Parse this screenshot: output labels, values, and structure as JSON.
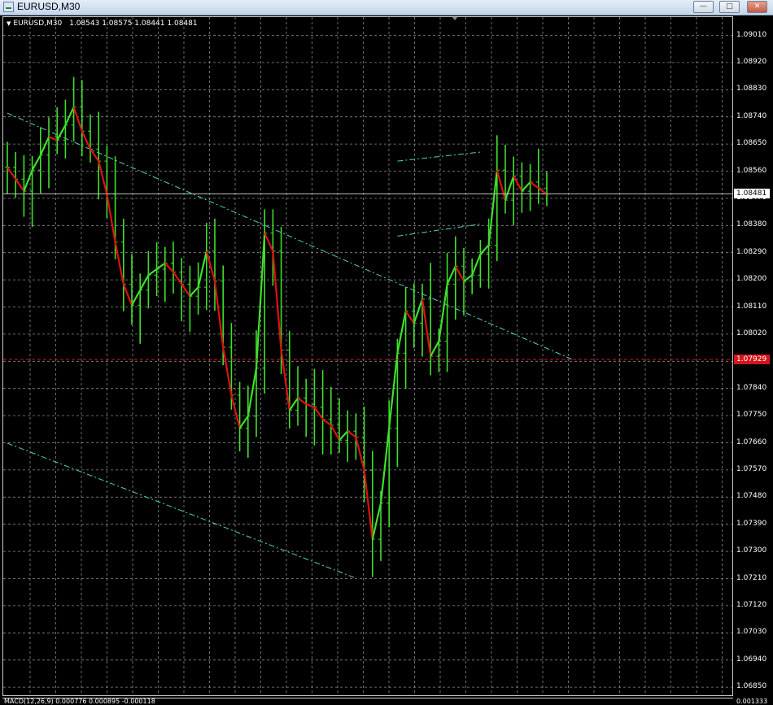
{
  "window": {
    "title": "EURUSD,M30",
    "buttons": {
      "minimize": "—",
      "maximize": "□",
      "close": "✕"
    }
  },
  "chart": {
    "info": {
      "symbol": "EURUSD,M30",
      "open": "1.08543",
      "high": "1.08575",
      "low": "1.08441",
      "close": "1.08481"
    },
    "price_ticks": [
      "1.09010",
      "1.08920",
      "1.08830",
      "1.08740",
      "1.08650",
      "1.08560",
      "1.08470",
      "1.08380",
      "1.08290",
      "1.08200",
      "1.08110",
      "1.08020",
      "1.07930",
      "1.07840",
      "1.07750",
      "1.07660",
      "1.07570",
      "1.07480",
      "1.07390",
      "1.07300",
      "1.07210",
      "1.07120",
      "1.07030",
      "1.06940",
      "1.06850"
    ],
    "bid_tag": "1.08481",
    "ref_tag": "1.07929",
    "colors": {
      "background": "#000000",
      "grid": "#8a8a8a",
      "bull": "#3fe02a",
      "bear": "#e01010",
      "trendline": "#4fd2c8",
      "ref_line": "#d4151b",
      "bid_line": "#c0c0c0"
    }
  },
  "chart_data": {
    "type": "line",
    "title": "EURUSD,M30",
    "xlabel": "",
    "ylabel": "",
    "ylim": [
      1.0681,
      1.0907
    ],
    "grid": true,
    "series": [
      {
        "values": [
          1.0857,
          1.0853,
          1.0849,
          1.0856,
          1.0861,
          1.0867,
          1.0866,
          1.0871,
          1.0877,
          1.0869,
          1.0863,
          1.0859,
          1.0848,
          1.0832,
          1.0818,
          1.0811,
          1.0816,
          1.0821,
          1.0823,
          1.0825,
          1.0822,
          1.0818,
          1.0814,
          1.0817,
          1.0829,
          1.0819,
          1.0797,
          1.0781,
          1.077,
          1.0774,
          1.079,
          1.0835,
          1.0829,
          1.0796,
          1.0776,
          1.078,
          1.0778,
          1.0777,
          1.0773,
          1.0771,
          1.0766,
          1.0769,
          1.0767,
          1.0756,
          1.0733,
          1.0745,
          1.077,
          1.0795,
          1.0809,
          1.0805,
          1.0813,
          1.0794,
          1.0799,
          1.0818,
          1.0824,
          1.0819,
          1.0821,
          1.0828,
          1.0831,
          1.0856,
          1.0846,
          1.0854,
          1.0849,
          1.0852,
          1.085,
          1.0848
        ]
      }
    ],
    "horizontal_lines": [
      1.07929,
      1.08481
    ],
    "trendlines": [
      {
        "from": [
          0,
          1.0875
        ],
        "to": [
          68,
          1.0793
        ]
      },
      {
        "from": [
          0,
          1.0765
        ],
        "to": [
          42,
          1.072
        ]
      },
      {
        "from": [
          47,
          1.0859
        ],
        "to": [
          57,
          1.0862
        ]
      },
      {
        "from": [
          47,
          1.0834
        ],
        "to": [
          57,
          1.0838
        ]
      }
    ]
  },
  "macd": {
    "label": "MACD(12,26,9) 0.000776 0.000895 -0.000118",
    "tick": "0.001333"
  }
}
